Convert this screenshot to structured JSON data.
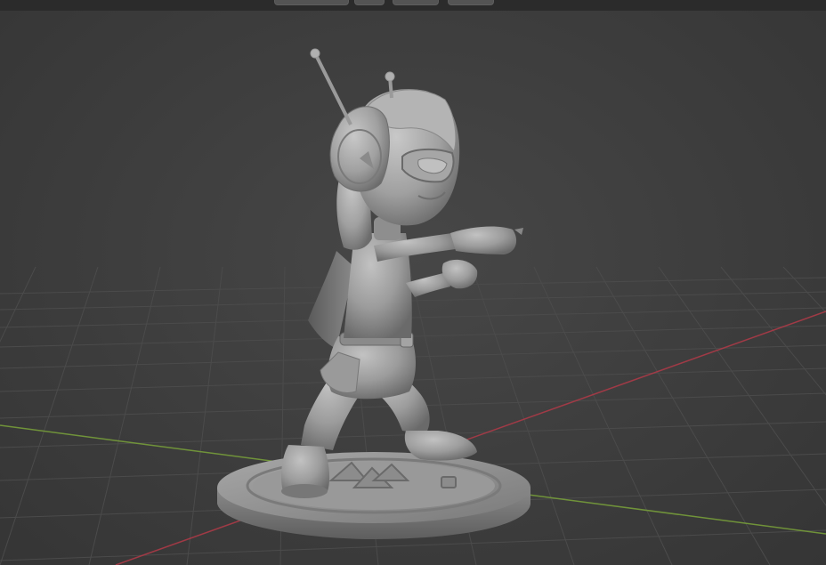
{
  "viewport": {
    "background": "#3d3d3d",
    "grid_color": "#4a4a4a",
    "x_axis_color": "#b23a48",
    "y_axis_color": "#7aa33a",
    "model_color": "#9a9a9a"
  },
  "header": {
    "buttons": [
      "viewport-shading-dropdown",
      "overlay-toggle",
      "gizmo-toggle",
      "xray-toggle"
    ]
  }
}
